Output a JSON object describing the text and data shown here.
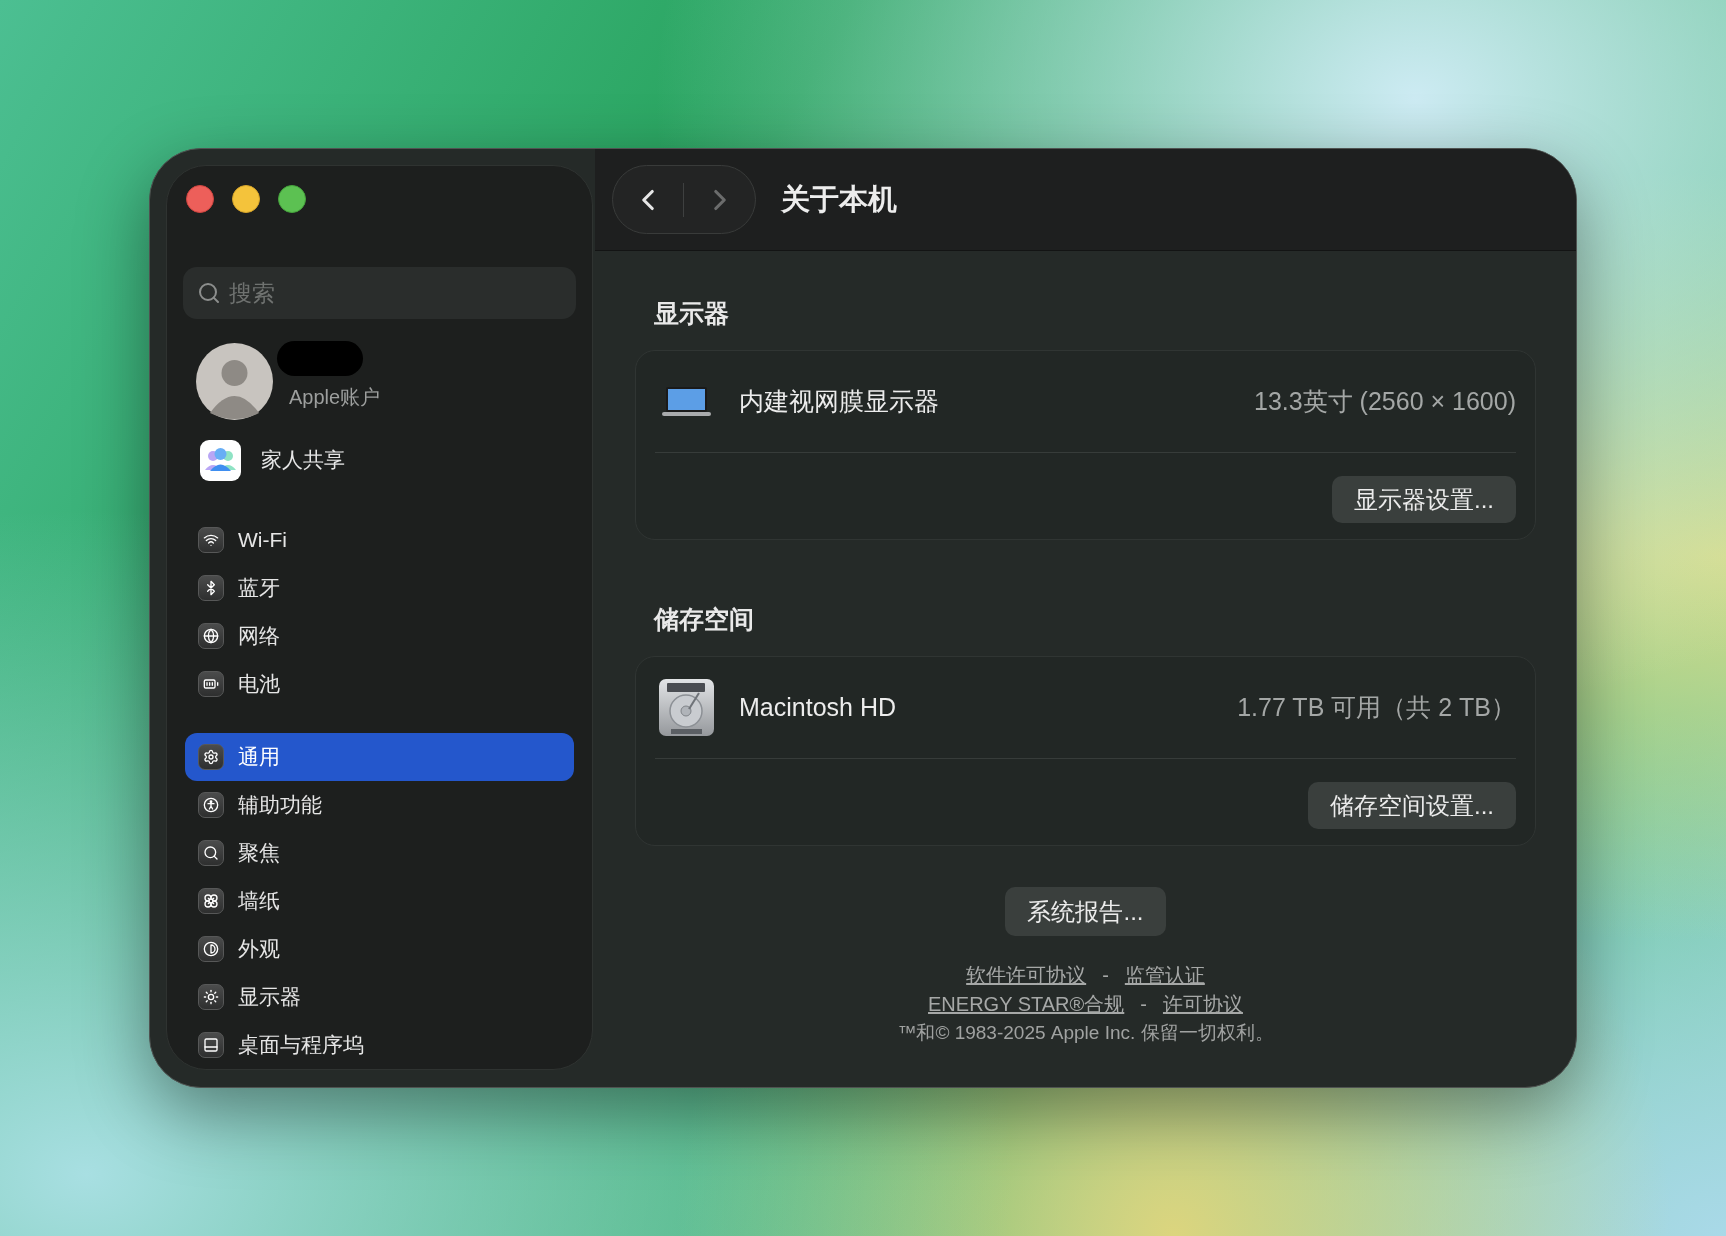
{
  "toolbar": {
    "back": {
      "disabled": false
    },
    "forward": {
      "disabled": true
    },
    "title": "关于本机"
  },
  "sidebar": {
    "search": {
      "placeholder": "搜索"
    },
    "account": {
      "label": "Apple账户"
    },
    "family": {
      "label": "家人共享"
    },
    "groups": [
      {
        "items": [
          {
            "label": "Wi-Fi",
            "selected": false
          },
          {
            "label": "蓝牙",
            "selected": false
          },
          {
            "label": "网络",
            "selected": false
          },
          {
            "label": "电池",
            "selected": false
          }
        ]
      },
      {
        "items": [
          {
            "label": "通用",
            "selected": true
          },
          {
            "label": "辅助功能",
            "selected": false
          },
          {
            "label": "聚焦",
            "selected": false
          },
          {
            "label": "墙纸",
            "selected": false
          },
          {
            "label": "外观",
            "selected": false
          },
          {
            "label": "显示器",
            "selected": false
          },
          {
            "label": "桌面与程序坞",
            "selected": false
          }
        ]
      }
    ]
  },
  "sections": [
    {
      "heading": "显示器",
      "kind": "display",
      "name": "内建视网膜显示器",
      "detail": "13.3英寸 (2560 × 1600)",
      "button": "显示器设置..."
    },
    {
      "heading": "储存空间",
      "kind": "disk",
      "name": "Macintosh HD",
      "detail": "1.77 TB 可用（共 2 TB）",
      "button": "储存空间设置..."
    }
  ],
  "footer": {
    "button": "系统报告...",
    "link_lines": [
      {
        "links": [
          "软件许可协议",
          "监管认证"
        ],
        "separator": "-"
      },
      {
        "links": [
          "ENERGY STAR®合规",
          "许可协议"
        ],
        "separator": "-"
      }
    ],
    "copyright": "™和© 1983-2025 Apple Inc. 保留一切权利。"
  }
}
